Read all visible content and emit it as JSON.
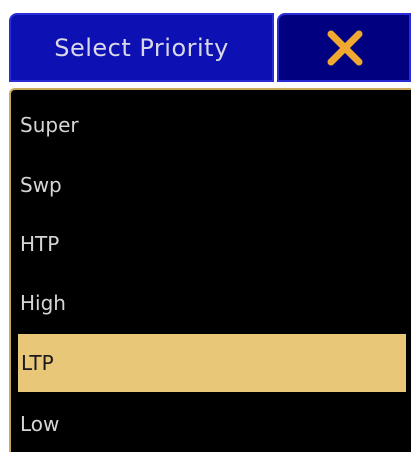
{
  "dialog": {
    "title": "Select Priority",
    "close_icon": "close-x-icon",
    "colors": {
      "header_bg": "#0d10b2",
      "header_border": "#2a2dd6",
      "close_bg": "#000080",
      "close_icon": "#f0a830",
      "list_bg": "#000000",
      "selected_bg": "#e8c878",
      "text": "#d6d6d6"
    }
  },
  "priority_options": [
    {
      "label": "Super",
      "selected": false
    },
    {
      "label": "Swp",
      "selected": false
    },
    {
      "label": "HTP",
      "selected": false
    },
    {
      "label": "High",
      "selected": false
    },
    {
      "label": "LTP",
      "selected": true
    },
    {
      "label": "Low",
      "selected": false
    }
  ]
}
